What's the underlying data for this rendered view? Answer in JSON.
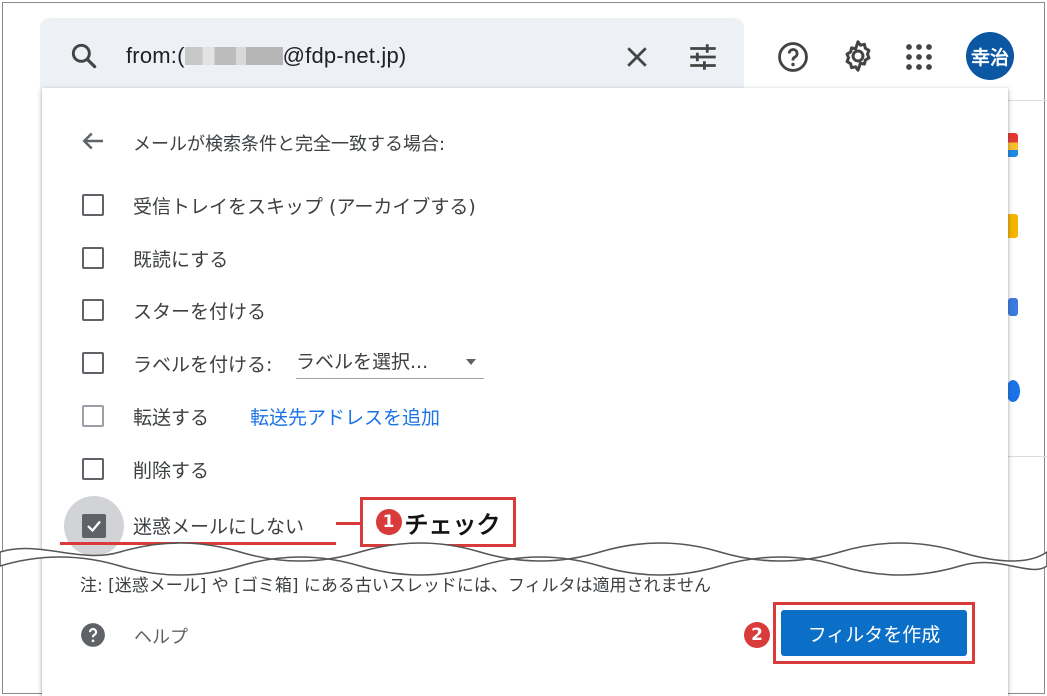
{
  "search": {
    "prefix": "from:(",
    "suffix": "@fdp-net.jp)"
  },
  "header": {
    "avatar_text": "幸治"
  },
  "filter": {
    "heading": "メールが検索条件と完全一致する場合:",
    "options": [
      {
        "label": "受信トレイをスキップ (アーカイブする)",
        "checked": false
      },
      {
        "label": "既読にする",
        "checked": false
      },
      {
        "label": "スターを付ける",
        "checked": false
      },
      {
        "label": "ラベルを付ける:",
        "checked": false,
        "select_value": "ラベルを選択..."
      },
      {
        "label": "転送する",
        "checked": false,
        "link": "転送先アドレスを追加"
      },
      {
        "label": "削除する",
        "checked": false
      },
      {
        "label": "迷惑メールにしない",
        "checked": true
      }
    ],
    "note": "注: [迷惑メール] や [ゴミ箱] にある古いスレッドには、フィルタは適用されません",
    "help_label": "ヘルプ",
    "create_button": "フィルタを作成"
  },
  "annotations": {
    "callout1_number": "1",
    "callout1_text": "チェック",
    "callout2_number": "2"
  },
  "colors": {
    "accent": "#0b6fc7",
    "callout_red": "#d93a3a",
    "avatar_bg": "#0b57a4"
  }
}
